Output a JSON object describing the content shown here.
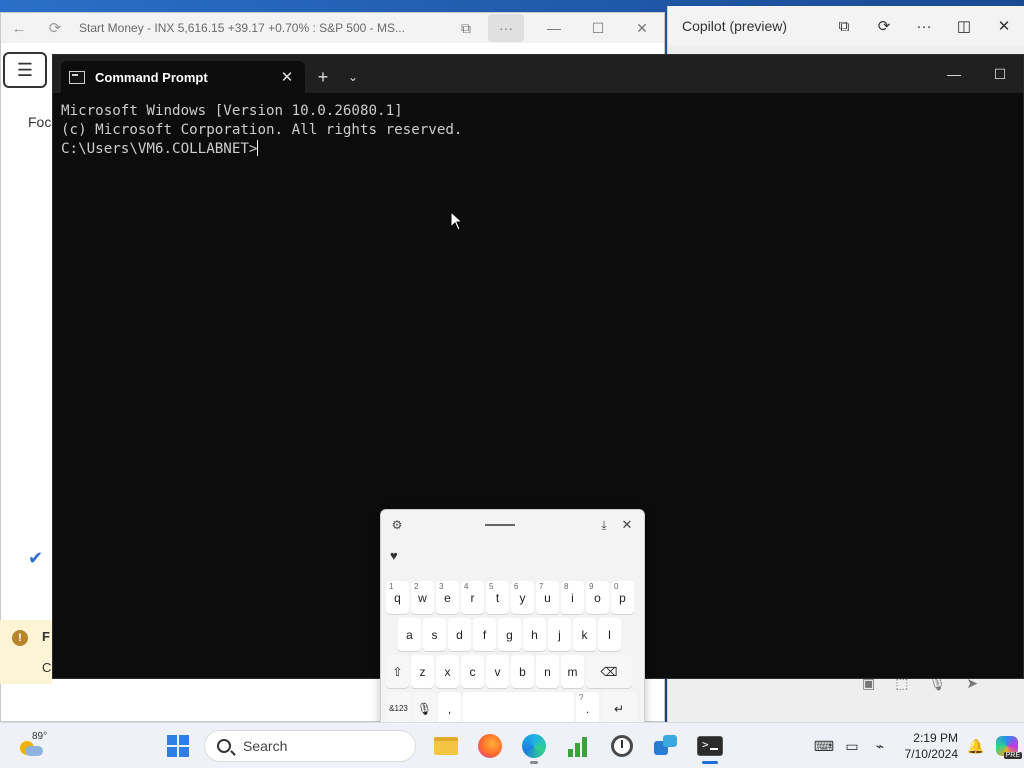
{
  "browser_window": {
    "title": "Start Money - INX 5,616.15 +39.17 +0.70% : S&P 500 - MS...",
    "partial_labels": {
      "focus": "Foc",
      "alert_title": "F",
      "alert_body": "C"
    }
  },
  "copilot_window": {
    "title": "Copilot (preview)"
  },
  "terminal": {
    "tab_title": "Command Prompt",
    "lines": [
      "Microsoft Windows [Version 10.0.26080.1]",
      "(c) Microsoft Corporation. All rights reserved.",
      "",
      "C:\\Users\\VM6.COLLABNET>"
    ]
  },
  "keyboard": {
    "row1": [
      {
        "key": "q",
        "hint": "1"
      },
      {
        "key": "w",
        "hint": "2"
      },
      {
        "key": "e",
        "hint": "3"
      },
      {
        "key": "r",
        "hint": "4"
      },
      {
        "key": "t",
        "hint": "5"
      },
      {
        "key": "y",
        "hint": "6"
      },
      {
        "key": "u",
        "hint": "7"
      },
      {
        "key": "i",
        "hint": "8"
      },
      {
        "key": "o",
        "hint": "9"
      },
      {
        "key": "p",
        "hint": "0"
      }
    ],
    "row2": [
      "a",
      "s",
      "d",
      "f",
      "g",
      "h",
      "j",
      "k",
      "l"
    ],
    "row3": [
      "z",
      "x",
      "c",
      "v",
      "b",
      "n",
      "m"
    ],
    "row4": {
      "symbols": "&123",
      "comma": ",",
      "period": ".",
      "period_hint": "?"
    }
  },
  "taskbar": {
    "weather_temp": "89°",
    "search_label": "Search",
    "time": "2:19 PM",
    "date": "7/10/2024",
    "copilot_badge": "PRE"
  }
}
